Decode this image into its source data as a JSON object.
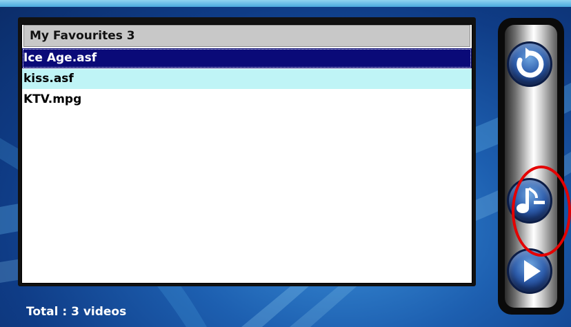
{
  "list": {
    "header": "My Favourites 3",
    "items": [
      {
        "label": "Ice Age.asf",
        "state": "selected"
      },
      {
        "label": "kiss.asf",
        "state": "highlighted"
      },
      {
        "label": "KTV.mpg",
        "state": "normal"
      }
    ]
  },
  "status": {
    "total_text": "Total : 3 videos"
  },
  "side_buttons": [
    {
      "name": "refresh",
      "icon": "refresh-icon"
    },
    {
      "name": "remove-favourite",
      "icon": "music-note-minus-icon"
    },
    {
      "name": "play",
      "icon": "play-icon"
    }
  ],
  "colors": {
    "selection_bg": "#0a0a78",
    "highlight_bg": "#bff4f6",
    "header_bg": "#c8c8c8",
    "annotation": "#e40000"
  }
}
